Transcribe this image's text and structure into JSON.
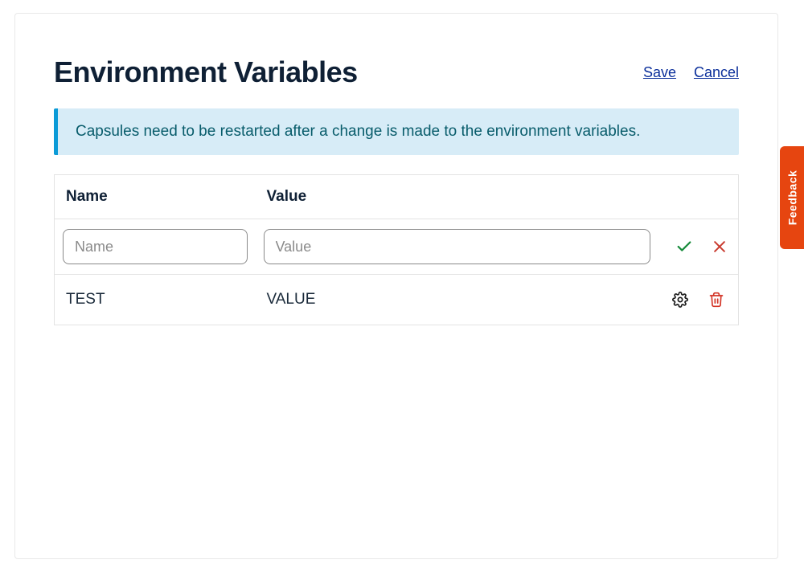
{
  "header": {
    "title": "Environment Variables",
    "save_label": "Save",
    "cancel_label": "Cancel"
  },
  "banner": {
    "message": "Capsules need to be restarted after a change is made to the environment variables."
  },
  "table": {
    "columns": {
      "name": "Name",
      "value": "Value"
    },
    "input_row": {
      "name_placeholder": "Name",
      "value_placeholder": "Value"
    },
    "rows": [
      {
        "name": "TEST",
        "value": "VALUE"
      }
    ]
  },
  "feedback": {
    "label": "Feedback"
  },
  "colors": {
    "accent_blue": "#0b9bd7",
    "link_blue": "#0b2f9b",
    "banner_bg": "#d7ecf7",
    "banner_text": "#085c6b",
    "confirm_green": "#168a3a",
    "cancel_red": "#c93a2e",
    "delete_red": "#d33426",
    "gear_gray": "#1a1a1a",
    "feedback_bg": "#e64510"
  }
}
